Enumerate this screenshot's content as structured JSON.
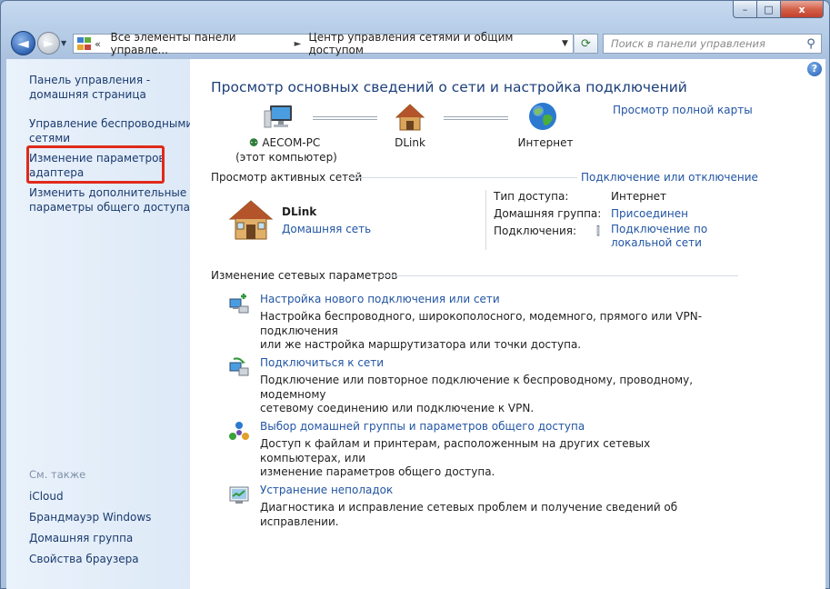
{
  "window": {
    "caption_buttons": {
      "minimize": "–",
      "maximize": "□",
      "close": "x"
    }
  },
  "nav": {
    "back_glyph": "◄",
    "forward_glyph": "►",
    "breadcrumb_chevron": "«",
    "breadcrumb": [
      "Все элементы панели управле...",
      "Центр управления сетями и общим доступом"
    ],
    "search_placeholder": "Поиск в панели управления"
  },
  "sidebar": {
    "items": [
      {
        "label_line1": "Панель управления -",
        "label_line2": "домашняя страница"
      },
      {
        "label_line1": "Управление беспроводными",
        "label_line2": "сетями"
      },
      {
        "label_line1": "Изменение параметров",
        "label_line2": "адаптера"
      },
      {
        "label_line1": "Изменить дополнительные",
        "label_line2": "параметры общего доступа"
      }
    ],
    "see_also_title": "См. также",
    "see_also": [
      "iCloud",
      "Брандмауэр Windows",
      "Домашняя группа",
      "Свойства браузера"
    ]
  },
  "main": {
    "title": "Просмотр основных сведений о сети и настройка подключений",
    "full_map_link": "Просмотр полной карты",
    "map": {
      "computer_name": "AECOM-PC",
      "computer_sub": "(этот компьютер)",
      "router_name": "DLink",
      "internet_name": "Интернет"
    },
    "active_networks": {
      "heading": "Просмотр активных сетей",
      "connect_link": "Подключение или отключение",
      "network_name": "DLink",
      "network_type": "Домашняя сеть",
      "labels": {
        "access": "Тип доступа:",
        "homegroup": "Домашняя группа:",
        "connections": "Подключения:"
      },
      "values": {
        "access": "Интернет",
        "homegroup": "Присоединен",
        "connection_line1": "Подключение по",
        "connection_line2": "локальной сети"
      }
    },
    "change_settings": {
      "heading": "Изменение сетевых параметров",
      "tasks": [
        {
          "title": "Настройка нового подключения или сети",
          "desc_line1": "Настройка беспроводного, широкополосного, модемного, прямого или VPN-подключения",
          "desc_line2": "или же настройка маршрутизатора или точки доступа."
        },
        {
          "title": "Подключиться к сети",
          "desc_line1": "Подключение или повторное подключение к беспроводному, проводному, модемному",
          "desc_line2": "сетевому соединению или подключение к VPN."
        },
        {
          "title": "Выбор домашней группы и параметров общего доступа",
          "desc_line1": "Доступ к файлам и принтерам, расположенным на других сетевых компьютерах, или",
          "desc_line2": "изменение параметров общего доступа."
        },
        {
          "title": "Устранение неполадок",
          "desc_line1": "Диагностика и исправление сетевых проблем и получение сведений об исправлении.",
          "desc_line2": ""
        }
      ]
    }
  },
  "colors": {
    "link": "#2255a4",
    "title": "#1c3f7a",
    "highlight": "#e02a1b"
  }
}
